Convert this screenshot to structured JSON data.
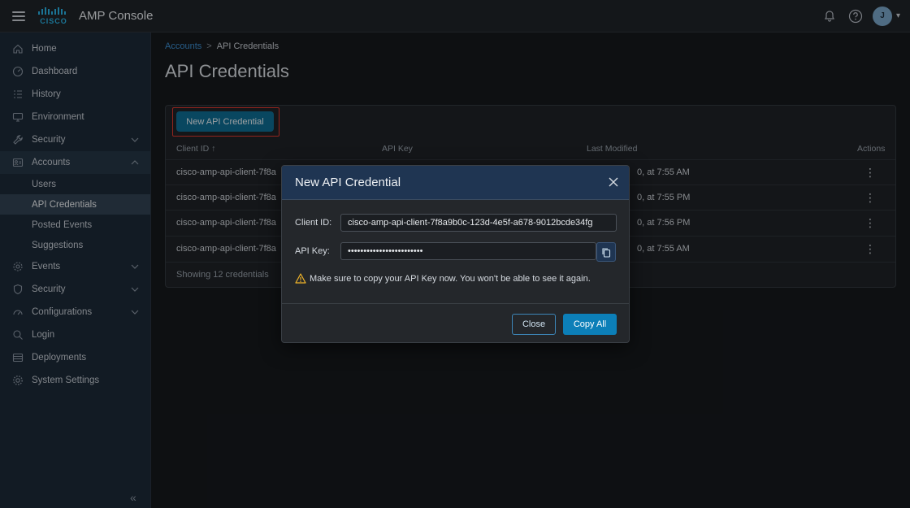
{
  "app": {
    "title": "AMP Console",
    "logo_text": "CISCO"
  },
  "topbar": {
    "avatar_initial": "J"
  },
  "sidebar": {
    "items": [
      {
        "label": "Home",
        "icon": "home-icon"
      },
      {
        "label": "Dashboard",
        "icon": "gauge-icon"
      },
      {
        "label": "History",
        "icon": "list-icon"
      },
      {
        "label": "Environment",
        "icon": "monitor-icon"
      },
      {
        "label": "Security",
        "icon": "wrench-icon"
      },
      {
        "label": "Accounts",
        "icon": "accounts-icon"
      }
    ],
    "accounts_sub": [
      {
        "label": "Users"
      },
      {
        "label": "API Credentials"
      },
      {
        "label": "Posted Events"
      },
      {
        "label": "Suggestions"
      }
    ],
    "items_after": [
      {
        "label": "Events",
        "icon": "gear-icon"
      },
      {
        "label": "Security",
        "icon": "shield-icon"
      },
      {
        "label": "Configurations",
        "icon": "gauge-icon"
      },
      {
        "label": "Login",
        "icon": "search-icon"
      },
      {
        "label": "Deployments",
        "icon": "server-icon"
      },
      {
        "label": "System Settings",
        "icon": "settings-icon"
      }
    ]
  },
  "breadcrumb": {
    "parent": "Accounts",
    "separator": ">",
    "current": "API Credentials"
  },
  "page": {
    "title": "API Credentials"
  },
  "panel": {
    "new_button_label": "New API Credential",
    "columns": {
      "client_id": "Client ID ↑",
      "api_key": "API Key",
      "last_modified": "Last Modified",
      "actions": "Actions"
    },
    "rows": [
      {
        "client_id": "cisco-amp-api-client-7f8a",
        "last_modified": "0, at 7:55 AM"
      },
      {
        "client_id": "cisco-amp-api-client-7f8a",
        "last_modified": "0, at 7:55 PM"
      },
      {
        "client_id": "cisco-amp-api-client-7f8a",
        "last_modified": "0, at 7:56 PM"
      },
      {
        "client_id": "cisco-amp-api-client-7f8a",
        "last_modified": "0, at 7:55 AM"
      }
    ],
    "footer": "Showing 12 credentials"
  },
  "modal": {
    "title": "New API Credential",
    "client_id_label": "Client ID:",
    "client_id_value": "cisco-amp-api-client-7f8a9b0c-123d-4e5f-a678-9012bcde34fg",
    "api_key_label": "API Key:",
    "api_key_value": "••••••••••••••••••••••••",
    "warning": "Make sure to copy your API Key now. You won't be able to see it again.",
    "close_label": "Close",
    "copy_all_label": "Copy All"
  },
  "colors": {
    "accent": "#0c7fb8",
    "highlight_outline": "#e03a2f",
    "sidebar_bg": "#1d2a38",
    "warning": "#f0b429"
  }
}
